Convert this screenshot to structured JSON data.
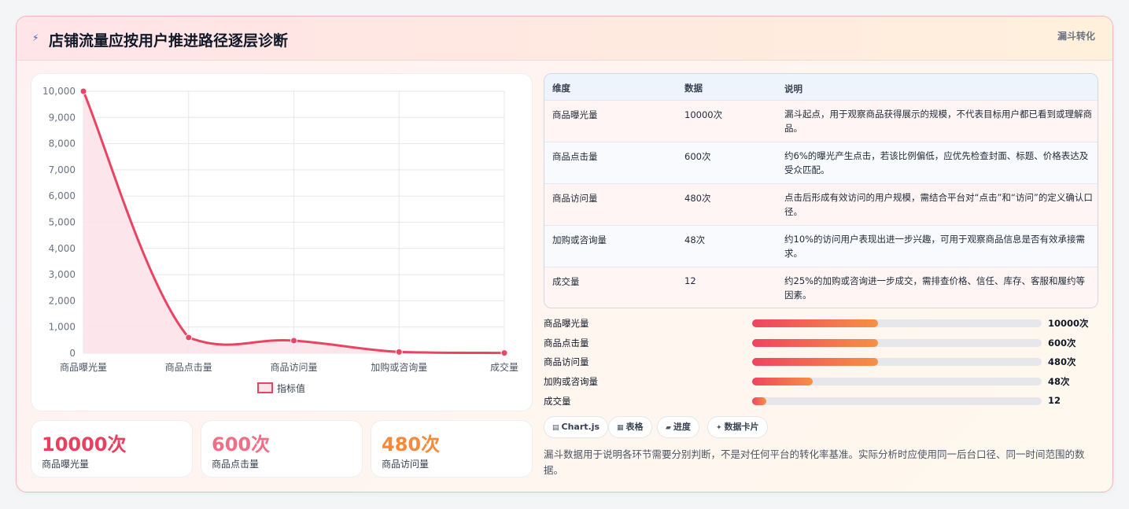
{
  "header": {
    "icon": "lightning-icon",
    "title": "店铺流量应按用户推进路径逐层诊断",
    "tag": "漏斗转化"
  },
  "colors": {
    "line": "#e84563",
    "area": "#fde2e7",
    "stat1": "#e8405e",
    "stat2": "#ef6f86",
    "stat3": "#f38a3c"
  },
  "chart_data": {
    "type": "line",
    "categories": [
      "商品曝光量",
      "商品点击量",
      "商品访问量",
      "加购或咨询量",
      "成交量"
    ],
    "series": [
      {
        "name": "指标值",
        "values": [
          10000,
          600,
          480,
          48,
          12
        ]
      }
    ],
    "ylim": [
      0,
      10000
    ],
    "yticks": [
      "0",
      "1,000",
      "2,000",
      "3,000",
      "4,000",
      "5,000",
      "6,000",
      "7,000",
      "8,000",
      "9,000",
      "10,000"
    ],
    "grid": true,
    "legend": "bottom",
    "fill": true,
    "smooth": true
  },
  "stats": [
    {
      "value": "10000次",
      "label": "商品曝光量"
    },
    {
      "value": "600次",
      "label": "商品点击量"
    },
    {
      "value": "480次",
      "label": "商品访问量"
    }
  ],
  "table": {
    "headers": [
      "维度",
      "数据",
      "说明"
    ],
    "rows": [
      [
        "商品曝光量",
        "10000次",
        "漏斗起点，用于观察商品获得展示的规模，不代表目标用户都已看到或理解商品。"
      ],
      [
        "商品点击量",
        "600次",
        "约6%的曝光产生点击，若该比例偏低，应优先检查封面、标题、价格表达及受众匹配。"
      ],
      [
        "商品访问量",
        "480次",
        "点击后形成有效访问的用户规模，需结合平台对“点击”和“访问”的定义确认口径。"
      ],
      [
        "加购或咨询量",
        "48次",
        "约10%的访问用户表现出进一步兴趣，可用于观察商品信息是否有效承接需求。"
      ],
      [
        "成交量",
        "12",
        "约25%的加购或咨询进一步成交，需排查价格、信任、库存、客服和履约等因素。"
      ]
    ]
  },
  "progress": [
    {
      "label": "商品曝光量",
      "value": "10000次",
      "fraction": 0.435
    },
    {
      "label": "商品点击量",
      "value": "600次",
      "fraction": 0.435
    },
    {
      "label": "商品访问量",
      "value": "480次",
      "fraction": 0.435
    },
    {
      "label": "加购或咨询量",
      "value": "48次",
      "fraction": 0.21
    },
    {
      "label": "成交量",
      "value": "12",
      "fraction": 0.05
    }
  ],
  "chips": [
    {
      "icon": "chart-icon",
      "glyph": "▤",
      "label": "Chart.js"
    },
    {
      "icon": "table-icon",
      "glyph": "▦",
      "label": "表格"
    },
    {
      "icon": "progress-icon",
      "glyph": "▰",
      "label": "进度"
    },
    {
      "icon": "sparkle-icon",
      "glyph": "✦",
      "label": "数据卡片"
    }
  ],
  "note": "漏斗数据用于说明各环节需要分别判断，不是对任何平台的转化率基准。实际分析时应使用同一后台口径、同一时间范围的数据。"
}
